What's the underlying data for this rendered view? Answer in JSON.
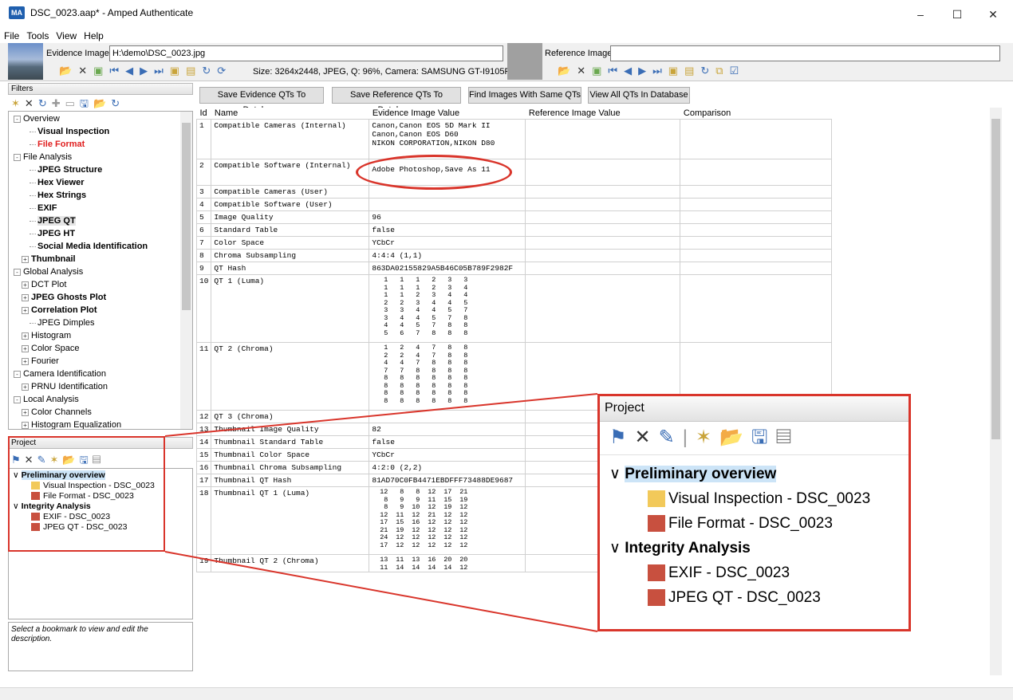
{
  "window": {
    "title": "DSC_0023.aap* - Amped Authenticate",
    "app_icon": "MA",
    "minimize": "–",
    "maximize": "☐",
    "close": "✕"
  },
  "menu": [
    "File",
    "Tools",
    "View",
    "Help"
  ],
  "evidence": {
    "label": "Evidence Image:",
    "path": "H:\\demo\\DSC_0023.jpg",
    "info": "Size: 3264x2448, JPEG, Q: 96%, Camera: SAMSUNG GT-I9105P"
  },
  "reference": {
    "label": "Reference Image:",
    "path": ""
  },
  "filters": {
    "header": "Filters",
    "items": [
      {
        "label": "Overview",
        "level": 0,
        "style": "normal",
        "expander": "-"
      },
      {
        "label": "Visual Inspection",
        "level": 2,
        "style": "bold"
      },
      {
        "label": "File Format",
        "level": 2,
        "style": "red"
      },
      {
        "label": "File Analysis",
        "level": 0,
        "style": "normal",
        "expander": "-"
      },
      {
        "label": "JPEG Structure",
        "level": 2,
        "style": "bold"
      },
      {
        "label": "Hex Viewer",
        "level": 2,
        "style": "bold"
      },
      {
        "label": "Hex Strings",
        "level": 2,
        "style": "bold"
      },
      {
        "label": "EXIF",
        "level": 2,
        "style": "bold"
      },
      {
        "label": "JPEG QT",
        "level": 2,
        "style": "bold",
        "selected": true
      },
      {
        "label": "JPEG HT",
        "level": 2,
        "style": "bold"
      },
      {
        "label": "Social Media Identification",
        "level": 2,
        "style": "bold"
      },
      {
        "label": "Thumbnail",
        "level": 1,
        "style": "bold",
        "expander": "+"
      },
      {
        "label": "Global Analysis",
        "level": 0,
        "style": "normal",
        "expander": "-"
      },
      {
        "label": "DCT Plot",
        "level": 1,
        "style": "normal",
        "expander": "+"
      },
      {
        "label": "JPEG Ghosts Plot",
        "level": 1,
        "style": "bold",
        "expander": "+"
      },
      {
        "label": "Correlation Plot",
        "level": 1,
        "style": "bold",
        "expander": "+"
      },
      {
        "label": "JPEG Dimples",
        "level": 2,
        "style": "normal"
      },
      {
        "label": "Histogram",
        "level": 1,
        "style": "normal",
        "expander": "+"
      },
      {
        "label": "Color Space",
        "level": 1,
        "style": "normal",
        "expander": "+"
      },
      {
        "label": "Fourier",
        "level": 1,
        "style": "normal",
        "expander": "+"
      },
      {
        "label": "Camera Identification",
        "level": 0,
        "style": "normal",
        "expander": "-"
      },
      {
        "label": "PRNU Identification",
        "level": 1,
        "style": "normal",
        "expander": "+"
      },
      {
        "label": "Local Analysis",
        "level": 0,
        "style": "normal",
        "expander": "-"
      },
      {
        "label": "Color Channels",
        "level": 1,
        "style": "normal",
        "expander": "+"
      },
      {
        "label": "Histogram Equalization",
        "level": 1,
        "style": "normal",
        "expander": "+"
      }
    ]
  },
  "project": {
    "header": "Project",
    "groups": [
      {
        "label": "Preliminary overview",
        "items": [
          {
            "label": "Visual Inspection - DSC_0023",
            "color": "#f2c95a"
          },
          {
            "label": "File Format - DSC_0023",
            "color": "#c8503f"
          }
        ]
      },
      {
        "label": "Integrity Analysis",
        "items": [
          {
            "label": "EXIF - DSC_0023",
            "color": "#c8503f"
          },
          {
            "label": "JPEG QT - DSC_0023",
            "color": "#c8503f"
          }
        ]
      }
    ],
    "description_hint": "Select a bookmark to view and edit the description."
  },
  "actions": {
    "save_evidence": "Save Evidence QTs To Database",
    "save_reference": "Save Reference QTs To Database",
    "find_same": "Find Images With Same QTs",
    "view_all": "View All QTs In Database"
  },
  "table": {
    "headers": [
      "Id",
      "Name",
      "Evidence Image Value",
      "Reference Image Value",
      "Comparison"
    ],
    "rows": [
      {
        "id": "1",
        "name": "Compatible Cameras (Internal)",
        "value": [
          "Canon,Canon EOS 5D Mark II",
          "Canon,Canon EOS D60",
          "NIKON CORPORATION,NIKON D80"
        ]
      },
      {
        "id": "2",
        "name": "Compatible Software (Internal)",
        "value": [
          "Adobe Photoshop,Save As 11"
        ]
      },
      {
        "id": "3",
        "name": "Compatible Cameras (User)",
        "value": [
          ""
        ]
      },
      {
        "id": "4",
        "name": "Compatible Software (User)",
        "value": [
          ""
        ]
      },
      {
        "id": "5",
        "name": "Image Quality",
        "value": [
          "96"
        ]
      },
      {
        "id": "6",
        "name": "Standard Table",
        "value": [
          "false"
        ]
      },
      {
        "id": "7",
        "name": "Color Space",
        "value": [
          "YCbCr"
        ]
      },
      {
        "id": "8",
        "name": "Chroma Subsampling",
        "value": [
          "4:4:4 (1,1)"
        ]
      },
      {
        "id": "9",
        "name": "QT Hash",
        "value": [
          "863DA02155829A5B46C05B789F2982F"
        ]
      },
      {
        "id": "10",
        "name": "QT 1 (Luma)",
        "matrix": [
          [
            1,
            1,
            1,
            2,
            3,
            3
          ],
          [
            1,
            1,
            1,
            2,
            3,
            4
          ],
          [
            1,
            1,
            2,
            3,
            4,
            4
          ],
          [
            2,
            2,
            3,
            4,
            4,
            5
          ],
          [
            3,
            3,
            4,
            4,
            5,
            7
          ],
          [
            3,
            4,
            4,
            5,
            7,
            8
          ],
          [
            4,
            4,
            5,
            7,
            8,
            8
          ],
          [
            5,
            6,
            7,
            8,
            8,
            8
          ]
        ]
      },
      {
        "id": "11",
        "name": "QT 2 (Chroma)",
        "matrix": [
          [
            1,
            2,
            4,
            7,
            8,
            8
          ],
          [
            2,
            2,
            4,
            7,
            8,
            8
          ],
          [
            4,
            4,
            7,
            8,
            8,
            8
          ],
          [
            7,
            7,
            8,
            8,
            8,
            8
          ],
          [
            8,
            8,
            8,
            8,
            8,
            8
          ],
          [
            8,
            8,
            8,
            8,
            8,
            8
          ],
          [
            8,
            8,
            8,
            8,
            8,
            8
          ],
          [
            8,
            8,
            8,
            8,
            8,
            8
          ]
        ]
      },
      {
        "id": "12",
        "name": "QT 3 (Chroma)",
        "value": [
          ""
        ]
      },
      {
        "id": "13",
        "name": "Thumbnail Image Quality",
        "value": [
          "82"
        ]
      },
      {
        "id": "14",
        "name": "Thumbnail Standard Table",
        "value": [
          "false"
        ]
      },
      {
        "id": "15",
        "name": "Thumbnail Color Space",
        "value": [
          "YCbCr"
        ]
      },
      {
        "id": "16",
        "name": "Thumbnail Chroma Subsampling",
        "value": [
          "4:2:0 (2,2)"
        ]
      },
      {
        "id": "17",
        "name": "Thumbnail QT Hash",
        "value": [
          "81AD70C0FB4471EBDFFF73488DE9687"
        ]
      },
      {
        "id": "18",
        "name": "Thumbnail QT 1 (Luma)",
        "matrix": [
          [
            12,
            8,
            8,
            12,
            17,
            21
          ],
          [
            8,
            9,
            9,
            11,
            15,
            19
          ],
          [
            8,
            9,
            10,
            12,
            19,
            12
          ],
          [
            12,
            11,
            12,
            21,
            12,
            12
          ],
          [
            17,
            15,
            16,
            12,
            12,
            12
          ],
          [
            21,
            19,
            12,
            12,
            12,
            12
          ],
          [
            24,
            12,
            12,
            12,
            12,
            12
          ],
          [
            17,
            12,
            12,
            12,
            12,
            12
          ]
        ]
      },
      {
        "id": "19",
        "name": "Thumbnail QT 2 (Chroma)",
        "matrix": [
          [
            13,
            11,
            13,
            16,
            20,
            20
          ],
          [
            11,
            14,
            14,
            14,
            14,
            12
          ]
        ]
      }
    ]
  }
}
